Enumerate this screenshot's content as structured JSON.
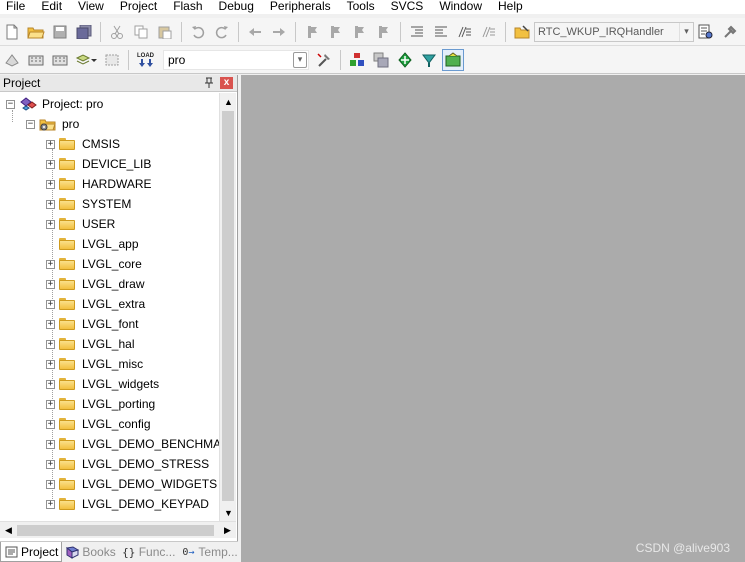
{
  "menu": [
    "File",
    "Edit",
    "View",
    "Project",
    "Flash",
    "Debug",
    "Peripherals",
    "Tools",
    "SVCS",
    "Window",
    "Help"
  ],
  "toolbar": {
    "function_combo_value": "RTC_WKUP_IRQHandler",
    "target_combo_value": "pro",
    "load_label": "LOAD"
  },
  "panel": {
    "title": "Project",
    "close_glyph": "x",
    "pin_glyph": "ᵖ"
  },
  "tree": {
    "root_label": "Project: pro",
    "target_label": "pro",
    "groups": [
      {
        "label": "CMSIS",
        "expandable": true
      },
      {
        "label": "DEVICE_LIB",
        "expandable": true
      },
      {
        "label": "HARDWARE",
        "expandable": true
      },
      {
        "label": "SYSTEM",
        "expandable": true
      },
      {
        "label": "USER",
        "expandable": true
      },
      {
        "label": "LVGL_app",
        "expandable": false
      },
      {
        "label": "LVGL_core",
        "expandable": true
      },
      {
        "label": "LVGL_draw",
        "expandable": true
      },
      {
        "label": "LVGL_extra",
        "expandable": true
      },
      {
        "label": "LVGL_font",
        "expandable": true
      },
      {
        "label": "LVGL_hal",
        "expandable": true
      },
      {
        "label": "LVGL_misc",
        "expandable": true
      },
      {
        "label": "LVGL_widgets",
        "expandable": true
      },
      {
        "label": "LVGL_porting",
        "expandable": true
      },
      {
        "label": "LVGL_config",
        "expandable": true
      },
      {
        "label": "LVGL_DEMO_BENCHMARK",
        "expandable": true
      },
      {
        "label": "LVGL_DEMO_STRESS",
        "expandable": true
      },
      {
        "label": "LVGL_DEMO_WIDGETS",
        "expandable": true
      },
      {
        "label": "LVGL_DEMO_KEYPAD",
        "expandable": true
      }
    ]
  },
  "bottom_tabs": [
    {
      "label": "Project",
      "active": true,
      "icon": "project-icon"
    },
    {
      "label": "Books",
      "active": false,
      "icon": "books-icon"
    },
    {
      "label": "Func...",
      "active": false,
      "icon": "functions-icon"
    },
    {
      "label": "Temp...",
      "active": false,
      "icon": "templates-icon"
    }
  ],
  "watermark": "CSDN @alive903",
  "colors": {
    "editor_bg": "#ababab",
    "folder": "#f2c040",
    "close": "#d9534f"
  }
}
